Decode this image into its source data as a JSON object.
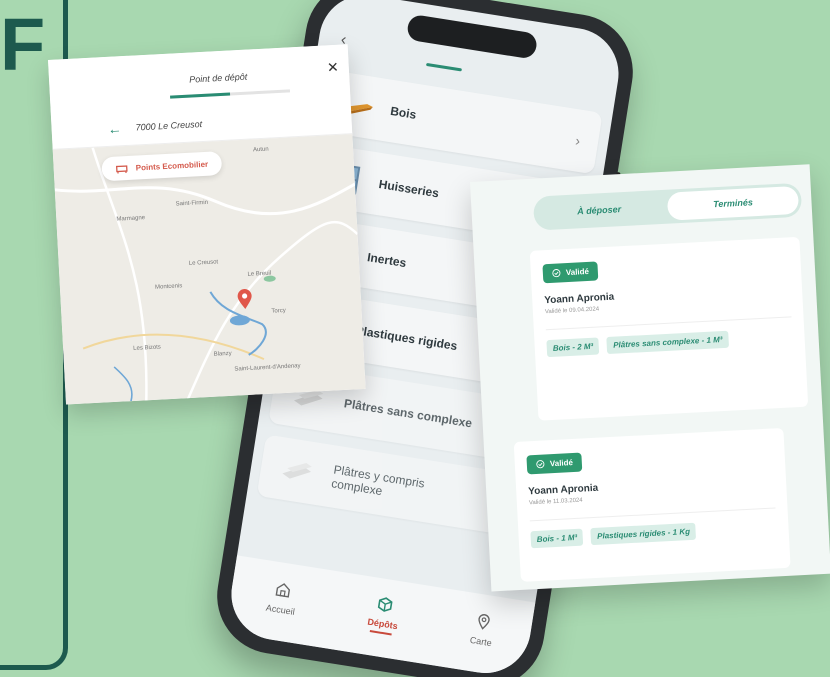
{
  "brand": {
    "letter": "F"
  },
  "map_card": {
    "title": "Point de dépôt",
    "location": "7000 Le Creusot",
    "chip_label": "Points Ecomobilier",
    "progress": 0.5,
    "places": [
      "Autun",
      "Saint-Firmin",
      "Marmagne",
      "Le Creusot",
      "Le Breuil",
      "Montcenis",
      "Torcy",
      "Les Bizots",
      "Blanzy",
      "Saint-Laurent-d'Andenay"
    ]
  },
  "phone": {
    "back_icon": "chevron-left-icon",
    "categories": [
      {
        "label": "Bois",
        "icon": "wood-icon",
        "chevron": "›"
      },
      {
        "label": "Huisseries",
        "icon": "window-icon"
      },
      {
        "label": "Inertes",
        "icon": "rubble-icon"
      },
      {
        "label": "Plastiques rigides",
        "icon": "plastic-icon"
      },
      {
        "label": "Plâtres sans complexe",
        "icon": "plaster-icon"
      },
      {
        "label": "Plâtres y compris complexe",
        "icon": "plaster-icon"
      }
    ],
    "nav": [
      {
        "label": "Accueil",
        "icon": "home-icon",
        "active": false
      },
      {
        "label": "Dépôts",
        "icon": "box-icon",
        "active": true
      },
      {
        "label": "Carte",
        "icon": "map-pin-icon",
        "active": false
      }
    ]
  },
  "deposits_card": {
    "tabs": [
      {
        "label": "À déposer",
        "active": false
      },
      {
        "label": "Terminés",
        "active": true
      }
    ],
    "entries": [
      {
        "status": "Validé",
        "name": "Yoann Apronia",
        "date": "Validé le 09.04.2024",
        "tags": [
          "Bois - 2 M³",
          "Plâtres sans complexe - 1 M³"
        ]
      },
      {
        "status": "Validé",
        "name": "Yoann Apronia",
        "date": "Validé le 11.03.2024",
        "tags": [
          "Bois - 1 M³",
          "Plastiques rigides - 1 Kg"
        ]
      }
    ]
  },
  "colors": {
    "background": "#a8d8b0",
    "accent": "#2a8c73",
    "brand_dark": "#1d5a4e",
    "badge": "#2f9a6f",
    "active_nav": "#c8493b"
  }
}
